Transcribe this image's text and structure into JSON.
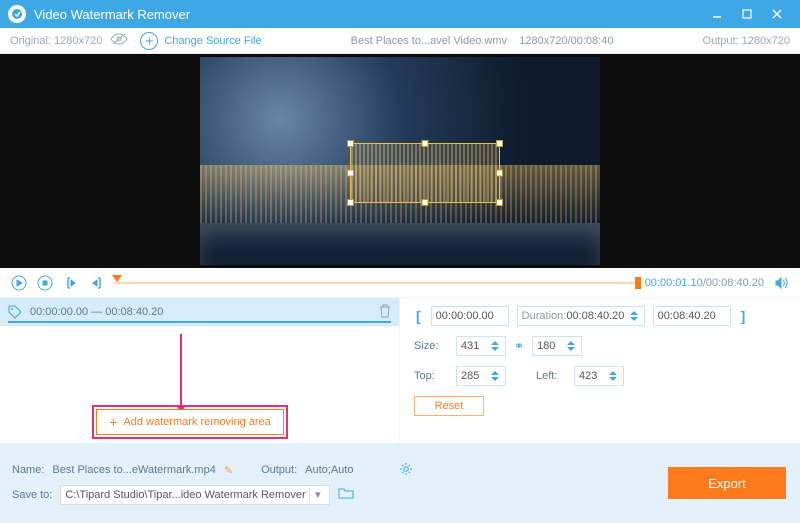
{
  "titlebar": {
    "app_name": "Video Watermark Remover"
  },
  "subbar": {
    "original_label": "Original:",
    "original_res": "1280x720",
    "change_source": "Change Source File",
    "file_name": "Best Places to...avel Video.wmv",
    "file_res": "1280x720",
    "file_dur": "00:08:40",
    "output_label": "Output:",
    "output_res": "1280x720"
  },
  "player": {
    "current": "00:00:01.10",
    "duration": "00:08:40.20"
  },
  "segment": {
    "start": "00:00:00.00",
    "sep": "—",
    "end": "00:08:40.20"
  },
  "addwm_label": "Add watermark removing area",
  "rp": {
    "time_start": "00:00:00.00",
    "duration_label": "Duration:",
    "duration_val": "00:08:40.20",
    "time_end": "00:08:40.20",
    "size_label": "Size:",
    "size_w": "431",
    "size_h": "180",
    "top_label": "Top:",
    "top_val": "285",
    "left_label": "Left:",
    "left_val": "423",
    "reset": "Reset"
  },
  "footer": {
    "name_label": "Name:",
    "name_val": "Best Places to...eWatermark.mp4",
    "output_label": "Output:",
    "output_val": "Auto;Auto",
    "save_label": "Save to:",
    "save_path": "C:\\Tipard Studio\\Tipar...ideo Watermark Remover",
    "export": "Export"
  }
}
